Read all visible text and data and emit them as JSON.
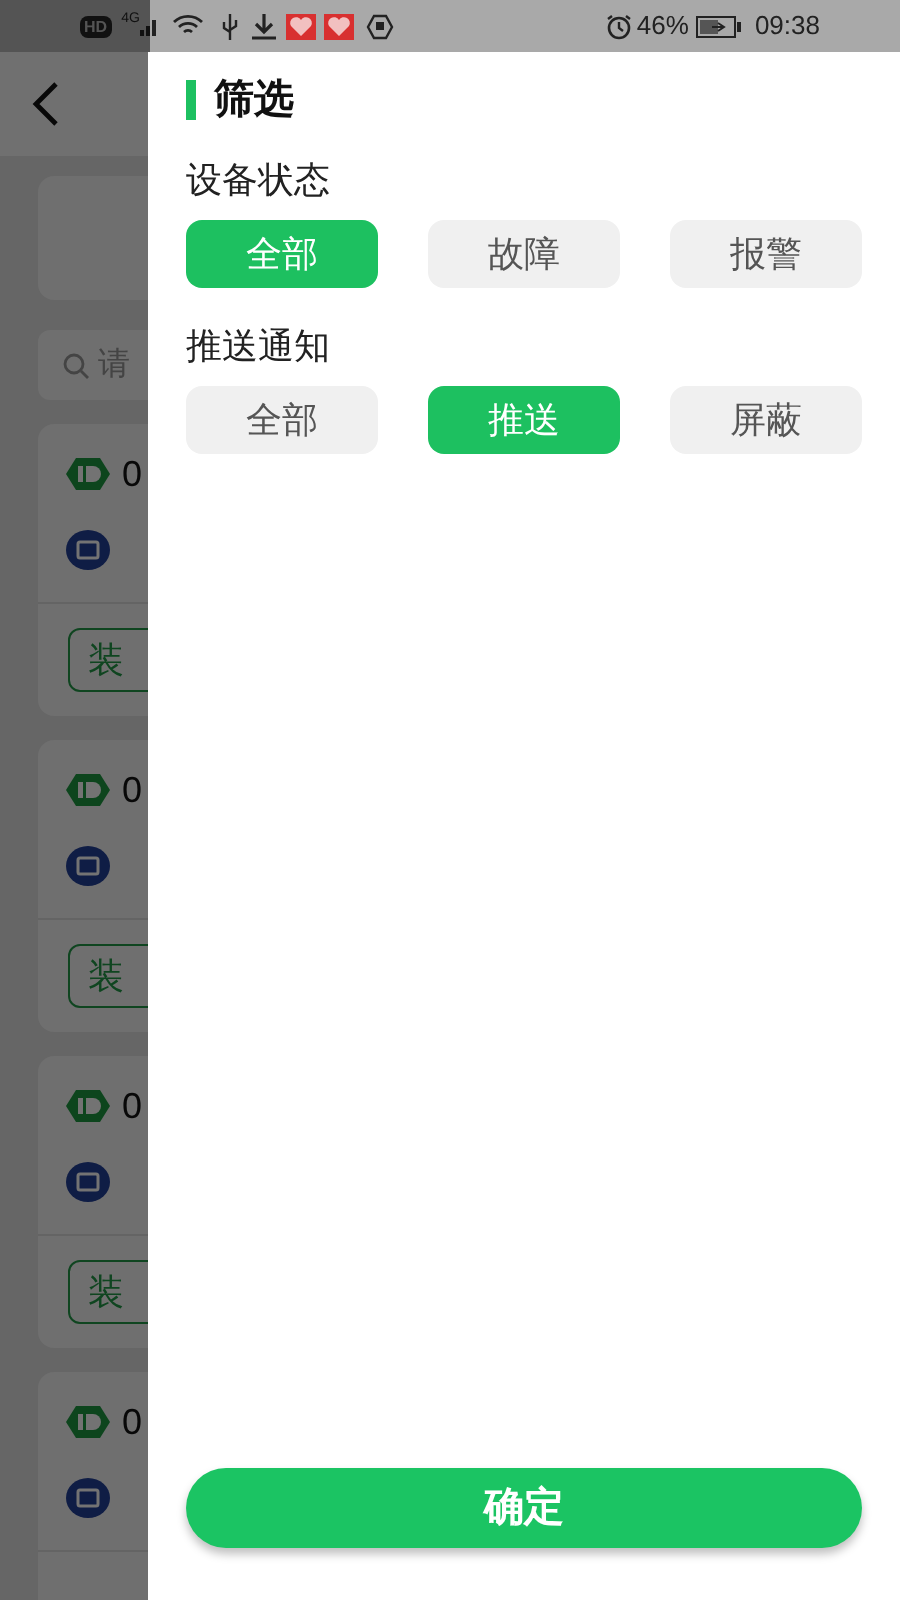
{
  "status_bar": {
    "network": "HD",
    "signal": "4G",
    "battery": "46%",
    "time": "09:38"
  },
  "background": {
    "search_placeholder": "请",
    "cards": [
      {
        "id": "0",
        "tag": "装"
      },
      {
        "id": "0",
        "tag": "装"
      },
      {
        "id": "0",
        "tag": "装"
      },
      {
        "id": "0"
      }
    ]
  },
  "drawer": {
    "title": "筛选",
    "sections": [
      {
        "label": "设备状态",
        "options": [
          {
            "label": "全部",
            "selected": true
          },
          {
            "label": "故障",
            "selected": false
          },
          {
            "label": "报警",
            "selected": false
          }
        ]
      },
      {
        "label": "推送通知",
        "options": [
          {
            "label": "全部",
            "selected": false
          },
          {
            "label": "推送",
            "selected": true
          },
          {
            "label": "屏蔽",
            "selected": false
          }
        ]
      }
    ],
    "confirm": "确定"
  }
}
